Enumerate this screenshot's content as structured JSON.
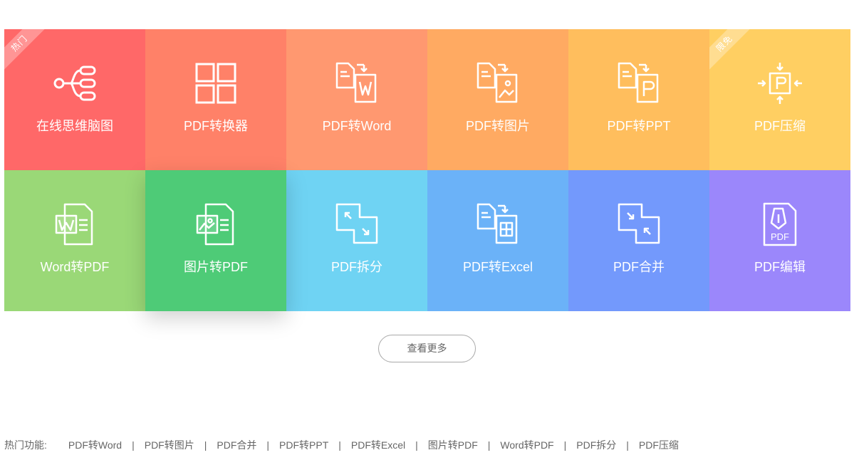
{
  "tiles": [
    {
      "label": "在线思维脑图",
      "icon": "mind-map-icon",
      "color": "#ff6868",
      "badge": "热门"
    },
    {
      "label": "PDF转换器",
      "icon": "grid-icon",
      "color": "#ff8168"
    },
    {
      "label": "PDF转Word",
      "icon": "pdf-to-word-icon",
      "color": "#ff9870"
    },
    {
      "label": "PDF转图片",
      "icon": "pdf-to-image-icon",
      "color": "#ffaa62"
    },
    {
      "label": "PDF转PPT",
      "icon": "pdf-to-ppt-icon",
      "color": "#ffbe5d"
    },
    {
      "label": "PDF压缩",
      "icon": "compress-icon",
      "color": "#ffcf62",
      "badge": "限免"
    },
    {
      "label": "Word转PDF",
      "icon": "word-doc-icon",
      "color": "#9ad877"
    },
    {
      "label": "图片转PDF",
      "icon": "image-doc-icon",
      "color": "#4ecb77"
    },
    {
      "label": "PDF拆分",
      "icon": "split-icon",
      "color": "#6fd3f3"
    },
    {
      "label": "PDF转Excel",
      "icon": "pdf-to-excel-icon",
      "color": "#6bb2f8"
    },
    {
      "label": "PDF合并",
      "icon": "merge-icon",
      "color": "#7399fc"
    },
    {
      "label": "PDF编辑",
      "icon": "pdf-edit-icon",
      "color": "#9b87fb"
    }
  ],
  "more_button": "查看更多",
  "hot_bar": {
    "label": "热门功能:",
    "links": [
      "PDF转Word",
      "PDF转图片",
      "PDF合并",
      "PDF转PPT",
      "PDF转Excel",
      "图片转PDF",
      "Word转PDF",
      "PDF拆分",
      "PDF压缩"
    ],
    "separator": "|"
  }
}
